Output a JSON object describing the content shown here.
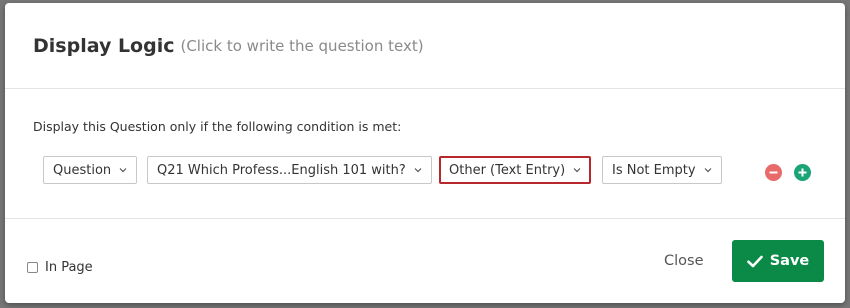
{
  "dialog": {
    "title": "Display Logic",
    "subtitle": "(Click to write the question text)"
  },
  "condition": {
    "label": "Display this Question only if the following condition is met:",
    "dropdowns": [
      {
        "name": "type",
        "value": "Question"
      },
      {
        "name": "question",
        "value": "Q21 Which Profess...English 101 with?"
      },
      {
        "name": "choice",
        "value": "Other (Text Entry)"
      },
      {
        "name": "operator",
        "value": "Is Not Empty"
      }
    ]
  },
  "footer": {
    "in_page_label": "In Page",
    "close_label": "Close",
    "save_label": "Save"
  },
  "colors": {
    "save_button": "#0b8a47",
    "remove_icon": "#e86a6a",
    "add_icon": "#1aa478",
    "highlight_border": "#b8272c"
  },
  "icons": [
    "chevron-down-icon",
    "minus-icon",
    "plus-icon",
    "check-icon"
  ]
}
